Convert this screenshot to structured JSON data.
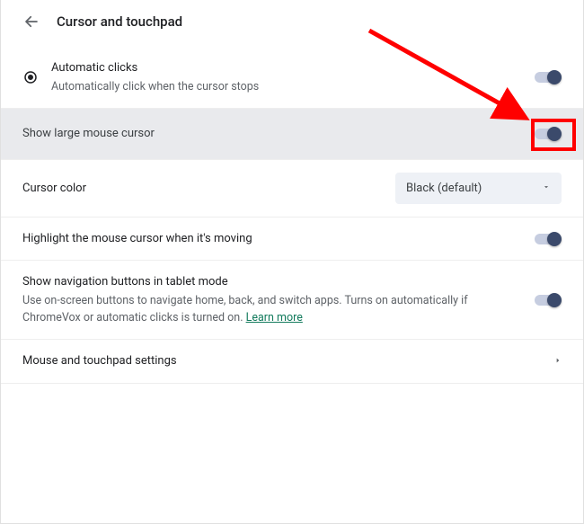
{
  "header": {
    "title": "Cursor and touchpad"
  },
  "rows": {
    "autoClicks": {
      "title": "Automatic clicks",
      "sub": "Automatically click when the cursor stops"
    },
    "largeCursor": {
      "title": "Show large mouse cursor"
    },
    "cursorColor": {
      "title": "Cursor color",
      "selectValue": "Black (default)"
    },
    "highlightMoving": {
      "title": "Highlight the mouse cursor when it's moving"
    },
    "navButtons": {
      "title": "Show navigation buttons in tablet mode",
      "sub": "Use on-screen buttons to navigate home, back, and switch apps. Turns on automatically if ChromeVox or automatic clicks is turned on. ",
      "learn": "Learn more"
    },
    "mouseTouchpad": {
      "title": "Mouse and touchpad settings"
    }
  }
}
